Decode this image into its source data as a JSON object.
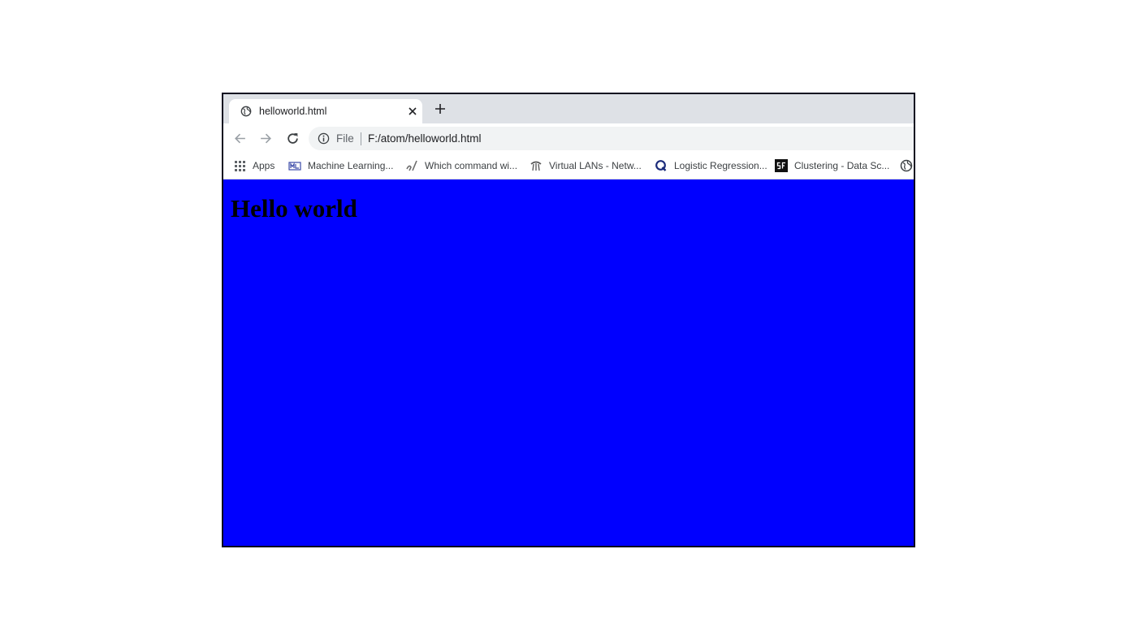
{
  "tab": {
    "title": "helloworld.html",
    "favicon": "globe-icon",
    "close_icon": "close-icon",
    "new_tab_icon": "plus-icon"
  },
  "toolbar": {
    "back_icon": "back-arrow-icon",
    "forward_icon": "forward-arrow-icon",
    "reload_icon": "reload-icon",
    "info_icon": "info-icon",
    "scheme_label": "File",
    "url": "F:/atom/helloworld.html"
  },
  "bookmarks": [
    {
      "label": "Apps",
      "icon": "apps-grid-icon"
    },
    {
      "label": "Machine Learning...",
      "icon": "machine-learning-site-icon"
    },
    {
      "label": "Which command wi...",
      "icon": "command-site-icon"
    },
    {
      "label": "Virtual LANs - Netw...",
      "icon": "virtual-lans-site-icon"
    },
    {
      "label": "Logistic Regression...",
      "icon": "q-logo-icon"
    },
    {
      "label": "Clustering - Data Sc...",
      "icon": "sf-logo-icon"
    },
    {
      "label": "",
      "icon": "globe-icon"
    }
  ],
  "page": {
    "heading": "Hello world",
    "background_color": "#0000ff"
  }
}
